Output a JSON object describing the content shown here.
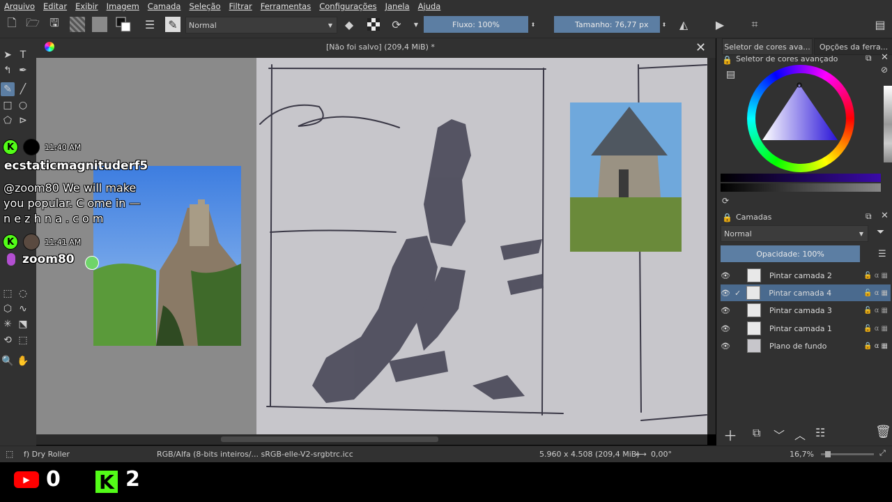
{
  "menu": [
    "Arquivo",
    "Editar",
    "Exibir",
    "Imagem",
    "Camada",
    "Seleção",
    "Filtrar",
    "Ferramentas",
    "Configurações",
    "Janela",
    "Ajuda"
  ],
  "toolbar": {
    "blend_mode": "Normal",
    "flow_label": "Fluxo: 100%",
    "size_label": "Tamanho: 76,77 px"
  },
  "document": {
    "title": "[Não foi salvo]  (209,4 MiB) *"
  },
  "dock": {
    "tab1": "Seletor de cores ava...",
    "tab2": "Opções da ferra...",
    "color_panel_title": "Seletor de cores avançado",
    "layers_title": "Camadas",
    "layer_blend": "Normal",
    "opacity_label": "Opacidade:  100%",
    "layers": [
      {
        "name": "Pintar camada 2",
        "selected": false
      },
      {
        "name": "Pintar camada 4",
        "selected": true
      },
      {
        "name": "Pintar camada 3",
        "selected": false
      },
      {
        "name": "Pintar camada 1",
        "selected": false
      },
      {
        "name": "Plano de fundo",
        "selected": false
      }
    ]
  },
  "status": {
    "brush": "f) Dry Roller",
    "color_space": "RGB/Alfa (8-bits inteiros/...  sRGB-elle-V2-srgbtrc.icc",
    "dimensions": "5.960 x 4.508 (209,4 MiB)",
    "rotation": "0,00°",
    "zoom": "16,7%"
  },
  "chat": {
    "msg1_time": "11:40 AM",
    "msg1_user": "ecstaticmagnituderf5",
    "msg1_line1": "@zoom80 We will make",
    "msg1_line2": "you popular. C ome in —",
    "msg1_line3": "n e z h n a . c o m",
    "msg2_time": "11:41 AM",
    "msg2_user": "zoom80"
  },
  "stream": {
    "youtube_count": "0",
    "kick_count": "2"
  },
  "colors": {
    "ui_bg": "#313131",
    "accent_blue": "#5c7ea3",
    "kick_green": "#53fc18",
    "youtube_red": "#ff0000"
  }
}
